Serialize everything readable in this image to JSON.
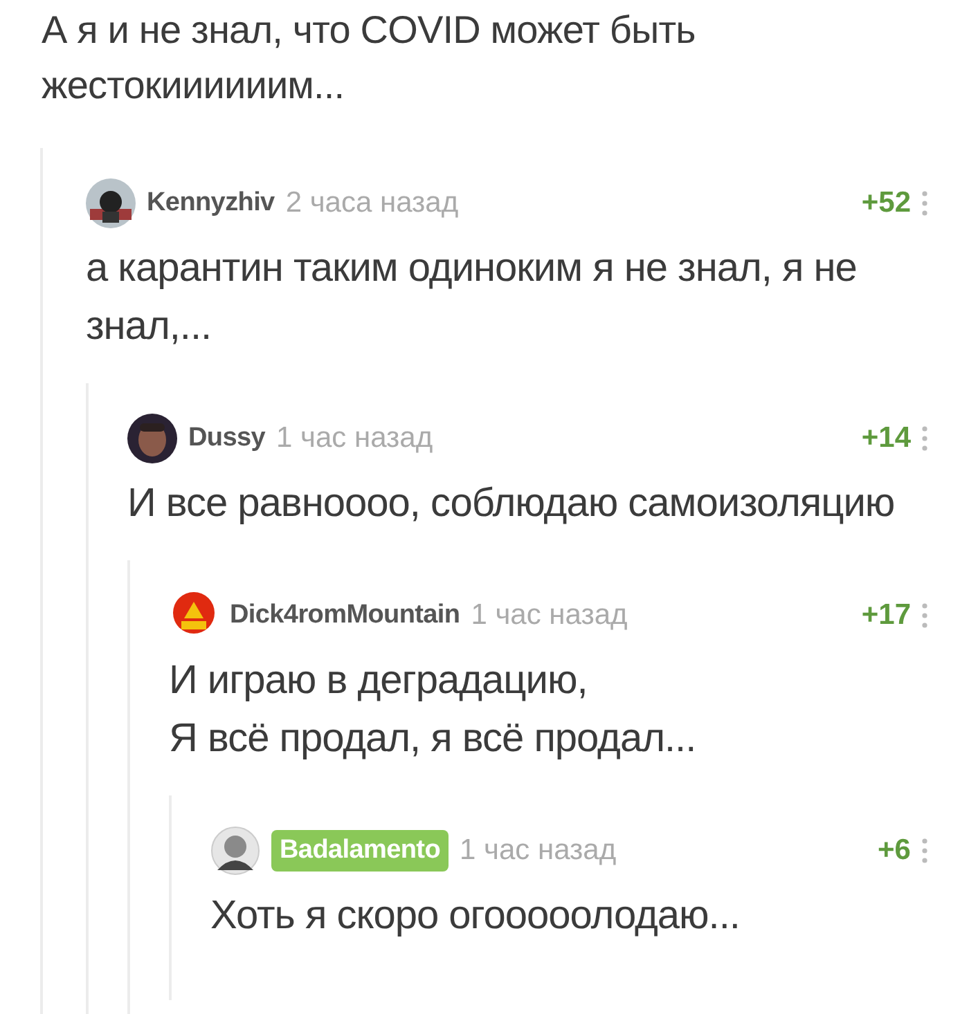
{
  "post_text": "А я и не знал, что COVID может быть жестокиииииим...",
  "comments": [
    {
      "author": "Kennyzhiv",
      "author_badge": false,
      "avatar": {
        "kind": "dark"
      },
      "time": "2 часа назад",
      "score": "+52",
      "text": "а карантин таким одиноким я не знал, я не знал,...",
      "children": [
        {
          "author": "Dussy",
          "author_badge": false,
          "avatar": {
            "kind": "brown"
          },
          "time": "1 час назад",
          "score": "+14",
          "text": "И все равноооо, соблюдаю самоизоляцию",
          "children": [
            {
              "author": "Dick4romMountain",
              "author_badge": false,
              "avatar": {
                "kind": "red"
              },
              "time": "1 час назад",
              "score": "+17",
              "text": "И играю в деградацию,\nЯ всё продал, я всё продал...",
              "children": [
                {
                  "author": "Badalamento",
                  "author_badge": true,
                  "avatar": {
                    "kind": "grey"
                  },
                  "time": "1 час назад",
                  "score": "+6",
                  "text": "Хоть я скоро огооооолодаю..."
                }
              ]
            }
          ]
        }
      ]
    }
  ]
}
